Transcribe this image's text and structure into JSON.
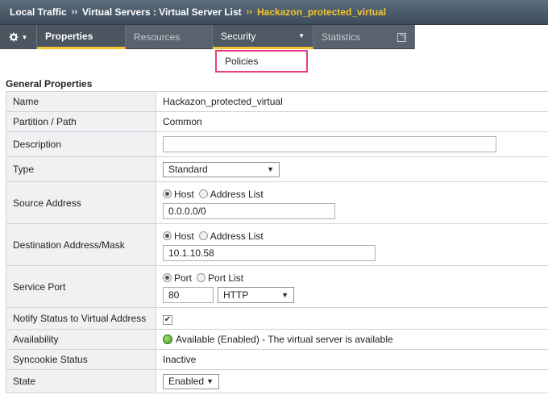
{
  "breadcrumb": {
    "part1": "Local Traffic",
    "part2": "Virtual Servers : Virtual Server List",
    "current": "Hackazon_protected_virtual",
    "sep": "››"
  },
  "tabs": {
    "properties": "Properties",
    "resources": "Resources",
    "security": "Security",
    "statistics": "Statistics"
  },
  "security_menu": {
    "policies": "Policies"
  },
  "section_title": "General Properties",
  "props": {
    "name_label": "Name",
    "name_value": "Hackazon_protected_virtual",
    "partition_label": "Partition / Path",
    "partition_value": "Common",
    "description_label": "Description",
    "description_value": "",
    "type_label": "Type",
    "type_value": "Standard",
    "source_label": "Source Address",
    "source_host_label": "Host",
    "source_list_label": "Address List",
    "source_value": "0.0.0.0/0",
    "dest_label": "Destination Address/Mask",
    "dest_host_label": "Host",
    "dest_list_label": "Address List",
    "dest_value": "10.1.10.58",
    "port_label": "Service Port",
    "port_radio_label": "Port",
    "port_list_label": "Port List",
    "port_value": "80",
    "port_service": "HTTP",
    "notify_label": "Notify Status to Virtual Address",
    "notify_checked": true,
    "availability_label": "Availability",
    "availability_value": "Available (Enabled) - The virtual server is available",
    "syncookie_label": "Syncookie Status",
    "syncookie_value": "Inactive",
    "state_label": "State",
    "state_value": "Enabled"
  },
  "colors": {
    "accent": "#f4c430",
    "menu_highlight": "#e6427a",
    "available": "#3f9d1f"
  }
}
